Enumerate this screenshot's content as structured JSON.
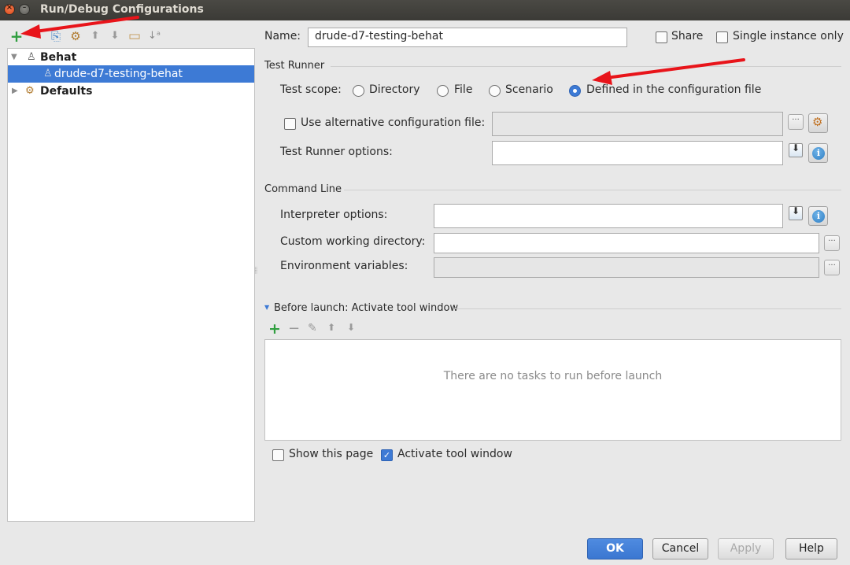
{
  "window": {
    "title": "Run/Debug Configurations",
    "close_glyph": "×",
    "minimize_glyph": "–"
  },
  "left_toolbar": {
    "icons": [
      {
        "name": "add-icon",
        "glyph": "+",
        "color": "#2f9e3f"
      },
      {
        "name": "remove-icon",
        "glyph": "−",
        "color": "#9a9a9a"
      },
      {
        "name": "copy-icon",
        "glyph": "⎘",
        "color": "#4a86c7"
      },
      {
        "name": "edit-defaults-icon",
        "glyph": "⚙",
        "color": "#b07a2e"
      },
      {
        "name": "move-up-icon",
        "glyph": "⬆",
        "color": "#9a9a9a"
      },
      {
        "name": "move-down-icon",
        "glyph": "⬇",
        "color": "#9a9a9a"
      },
      {
        "name": "folder-icon",
        "glyph": "▭",
        "color": "#c39a5a"
      },
      {
        "name": "sort-icon",
        "glyph": "↓ᵃ",
        "color": "#8a8a8a"
      }
    ]
  },
  "tree": {
    "items": [
      {
        "label": "Behat",
        "expanded": true,
        "bold": true,
        "level": 0
      },
      {
        "label": "drude-d7-testing-behat",
        "selected": true,
        "level": 1
      },
      {
        "label": "Defaults",
        "expanded": false,
        "bold": true,
        "level": 0
      }
    ],
    "expanded_glyph": "▼",
    "collapsed_glyph": "▶"
  },
  "form": {
    "name_label": "Name:",
    "name_value": "drude-d7-testing-behat",
    "share_label": "Share",
    "share_checked": false,
    "single_instance_label": "Single instance only",
    "single_instance_checked": false,
    "test_runner_section": "Test Runner",
    "test_scope_label": "Test scope:",
    "scope_options": [
      {
        "label": "Directory",
        "checked": false
      },
      {
        "label": "File",
        "checked": false
      },
      {
        "label": "Scenario",
        "checked": false
      },
      {
        "label": "Defined in the configuration file",
        "checked": true
      }
    ],
    "alt_config_label": "Use alternative configuration file:",
    "alt_config_checked": false,
    "alt_config_value": "",
    "test_runner_options_label": "Test Runner options:",
    "test_runner_options_value": "",
    "command_line_section": "Command Line",
    "interpreter_options_label": "Interpreter options:",
    "interpreter_options_value": "",
    "working_dir_label": "Custom working directory:",
    "working_dir_value": "",
    "env_vars_label": "Environment variables:",
    "env_vars_value": "",
    "browse_glyph": "···",
    "info_glyph": "i"
  },
  "before_launch": {
    "title": "Before launch: Activate tool window",
    "toolbar": [
      {
        "name": "add-task-icon",
        "glyph": "+",
        "color": "#2f9e3f"
      },
      {
        "name": "remove-task-icon",
        "glyph": "−",
        "color": "#9a9a9a"
      },
      {
        "name": "edit-task-icon",
        "glyph": "✎",
        "color": "#9a9a9a"
      },
      {
        "name": "task-up-icon",
        "glyph": "⬆",
        "color": "#9a9a9a"
      },
      {
        "name": "task-down-icon",
        "glyph": "⬇",
        "color": "#9a9a9a"
      }
    ],
    "empty_text": "There are no tasks to run before launch",
    "show_page_label": "Show this page",
    "show_page_checked": false,
    "activate_tool_window_label": "Activate tool window",
    "activate_tool_window_checked": true,
    "check_glyph": "✓"
  },
  "buttons": {
    "ok": "OK",
    "cancel": "Cancel",
    "apply": "Apply",
    "help": "Help"
  },
  "colors": {
    "accent": "#3d7ad5",
    "annotation_arrow": "#e8141a"
  }
}
